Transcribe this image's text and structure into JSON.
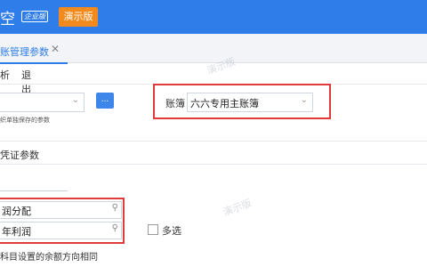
{
  "header": {
    "app_title": "空",
    "edition_badge": "企业版",
    "demo_button": "演示版"
  },
  "tabs": [
    {
      "label": "账管理参数",
      "close": "✕"
    }
  ],
  "toolbar": {
    "items": [
      "析",
      "退出"
    ]
  },
  "form": {
    "left_select_value": "",
    "more_button": "...",
    "note": "织单独保存的参数",
    "book_label": "账簿",
    "book_value": "六六专用主账簿",
    "section_title": "凭证参数",
    "inputs": [
      "润分配",
      "年利润"
    ],
    "multi_select_label": "多选",
    "description": "科目设置的余额方向相同"
  },
  "watermark": "演示版",
  "colors": {
    "topbar": "#2f7de8",
    "demo_button": "#f28a1d",
    "highlight": "#e03b3b"
  }
}
